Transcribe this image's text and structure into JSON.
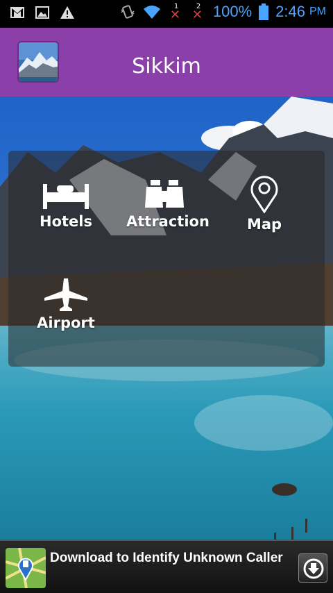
{
  "status_bar": {
    "icons": [
      "gmail-icon",
      "image-icon",
      "warning-icon",
      "vibrate-icon",
      "wifi-icon",
      "sim1-no-signal-icon",
      "sim2-no-signal-icon",
      "battery-icon"
    ],
    "sim1_label": "1",
    "sim2_label": "2",
    "battery_text": "100%",
    "time": "2:46",
    "ampm": "PM"
  },
  "header": {
    "title": "Sikkim",
    "background_color": "#8b3fa8"
  },
  "menu": {
    "items": [
      {
        "label": "Hotels",
        "icon": "bed-icon"
      },
      {
        "label": "Attraction",
        "icon": "binoculars-icon"
      },
      {
        "label": "Map",
        "icon": "map-pin-icon"
      },
      {
        "label": "Airport",
        "icon": "airplane-icon"
      }
    ]
  },
  "ad": {
    "text": "Download to Identify Unknown Caller",
    "icon": "caller-map-icon",
    "button_icon": "download-icon"
  }
}
